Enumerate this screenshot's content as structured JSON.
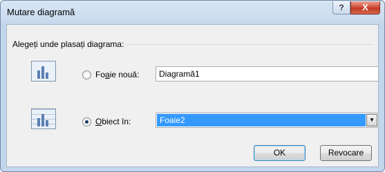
{
  "window": {
    "title": "Mutare diagramă",
    "help_glyph": "?",
    "close_glyph": "X"
  },
  "group": {
    "label": "Alegeți unde plasați diagrama:"
  },
  "options": {
    "new_sheet": {
      "label_before": "Fo",
      "label_accel": "a",
      "label_after": "ie nouă:",
      "selected": false,
      "value": "Diagramă1"
    },
    "object_in": {
      "label_before": "",
      "label_accel": "O",
      "label_after": "biect în:",
      "selected": true,
      "value": "Foaie2"
    }
  },
  "buttons": {
    "ok": "OK",
    "cancel": "Revocare"
  },
  "icons": {
    "new_sheet_icon": "chart-sheet-icon",
    "object_icon": "embedded-chart-icon",
    "dropdown_icon": "chevron-down-icon"
  }
}
